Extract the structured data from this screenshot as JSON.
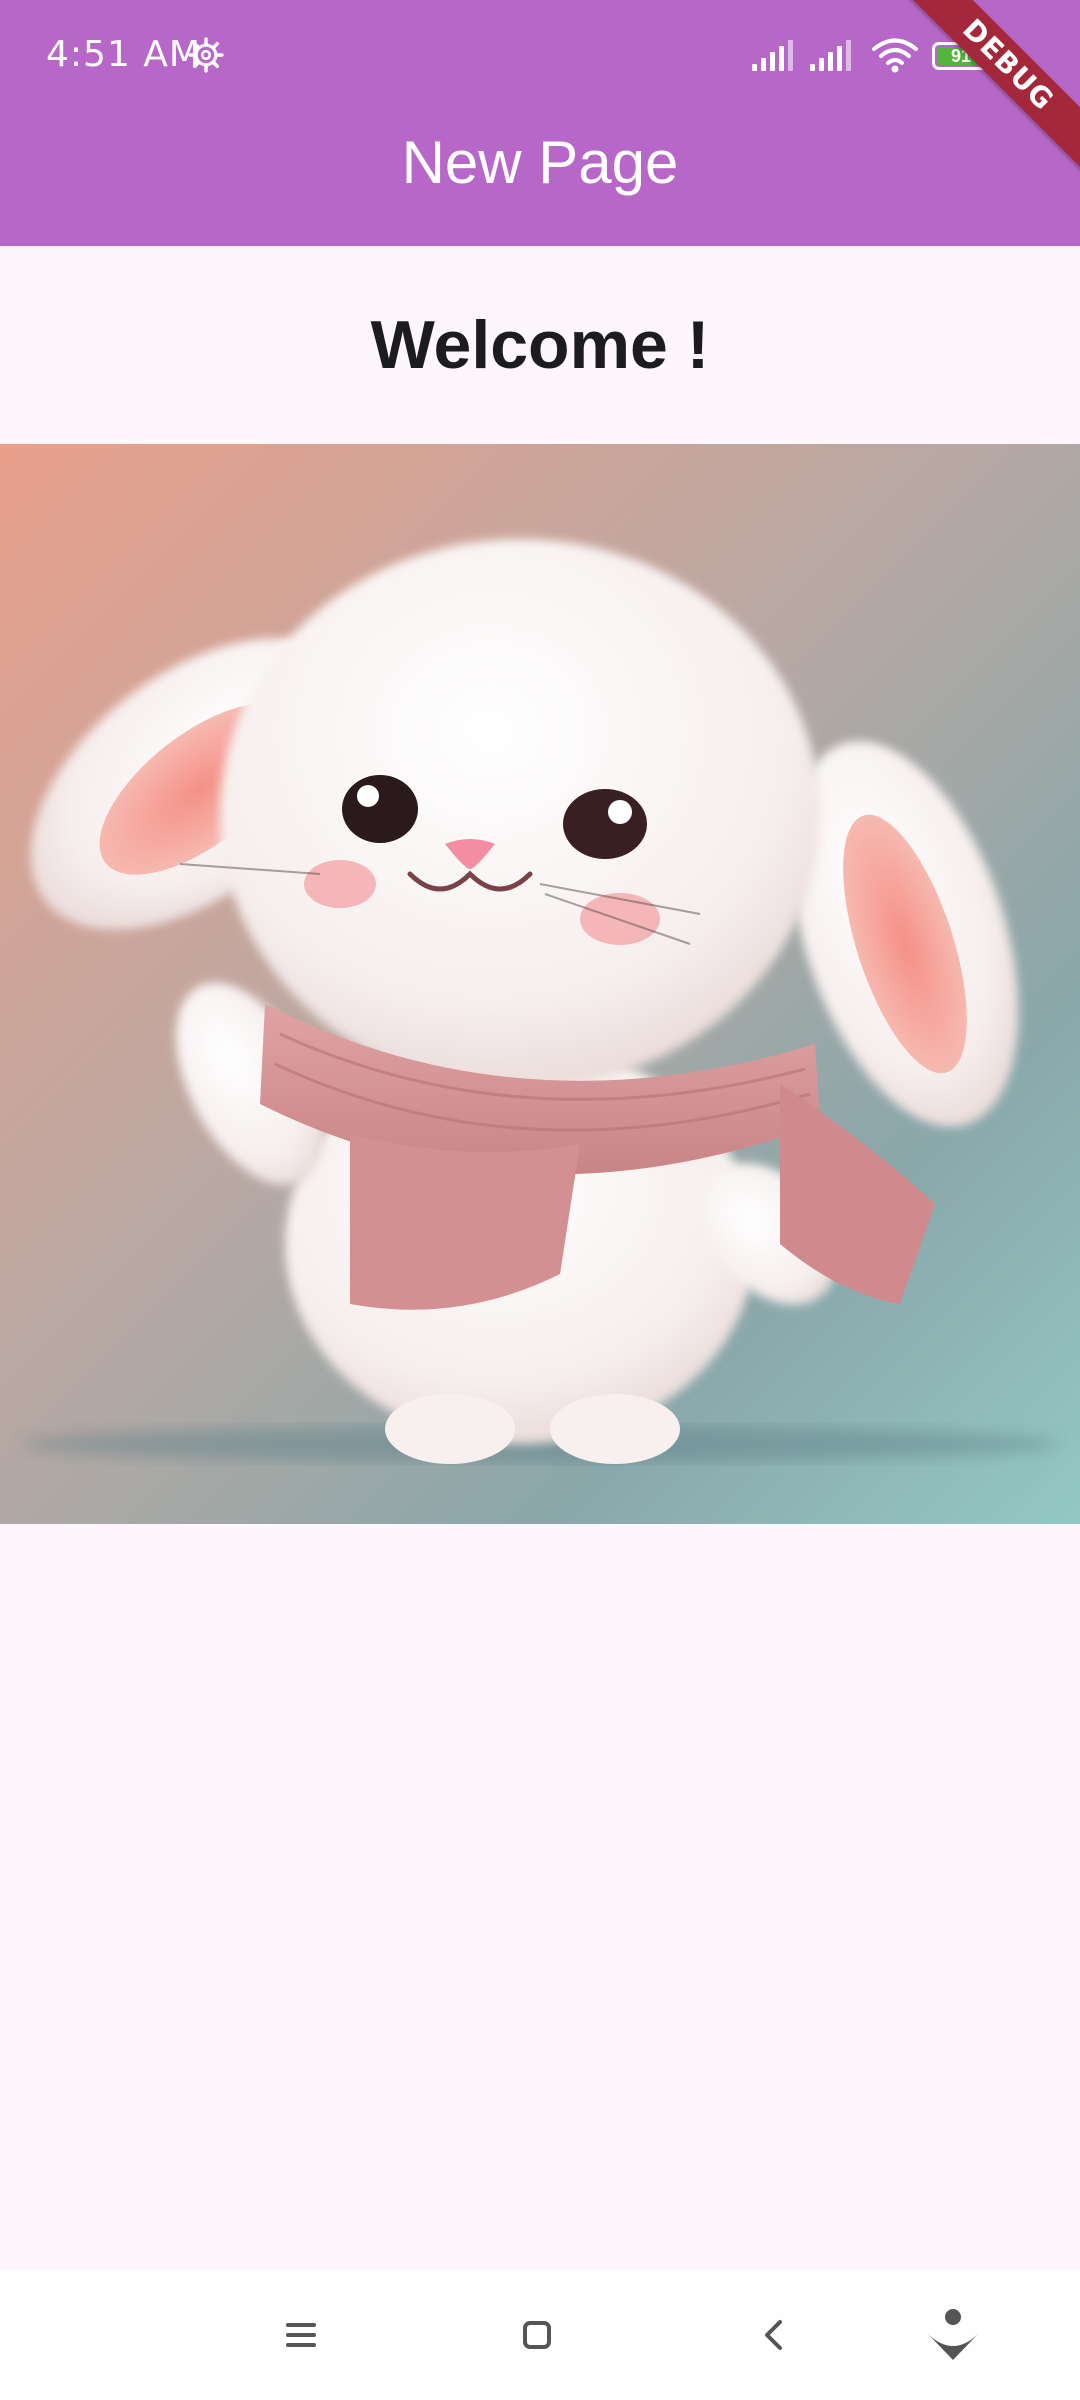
{
  "status_bar": {
    "time": "4:51 AM",
    "battery_level": "91",
    "icons": [
      "settings-gear-icon",
      "signal-icon",
      "signal-icon",
      "wifi-icon",
      "battery-icon"
    ]
  },
  "debug_banner": "DEBUG",
  "app_bar": {
    "title": "New Page",
    "color": "#b767c8"
  },
  "main": {
    "heading": "Welcome !"
  },
  "nav_bar": {
    "icons": [
      "menu-icon",
      "home-icon",
      "back-icon",
      "assistant-icon"
    ]
  }
}
